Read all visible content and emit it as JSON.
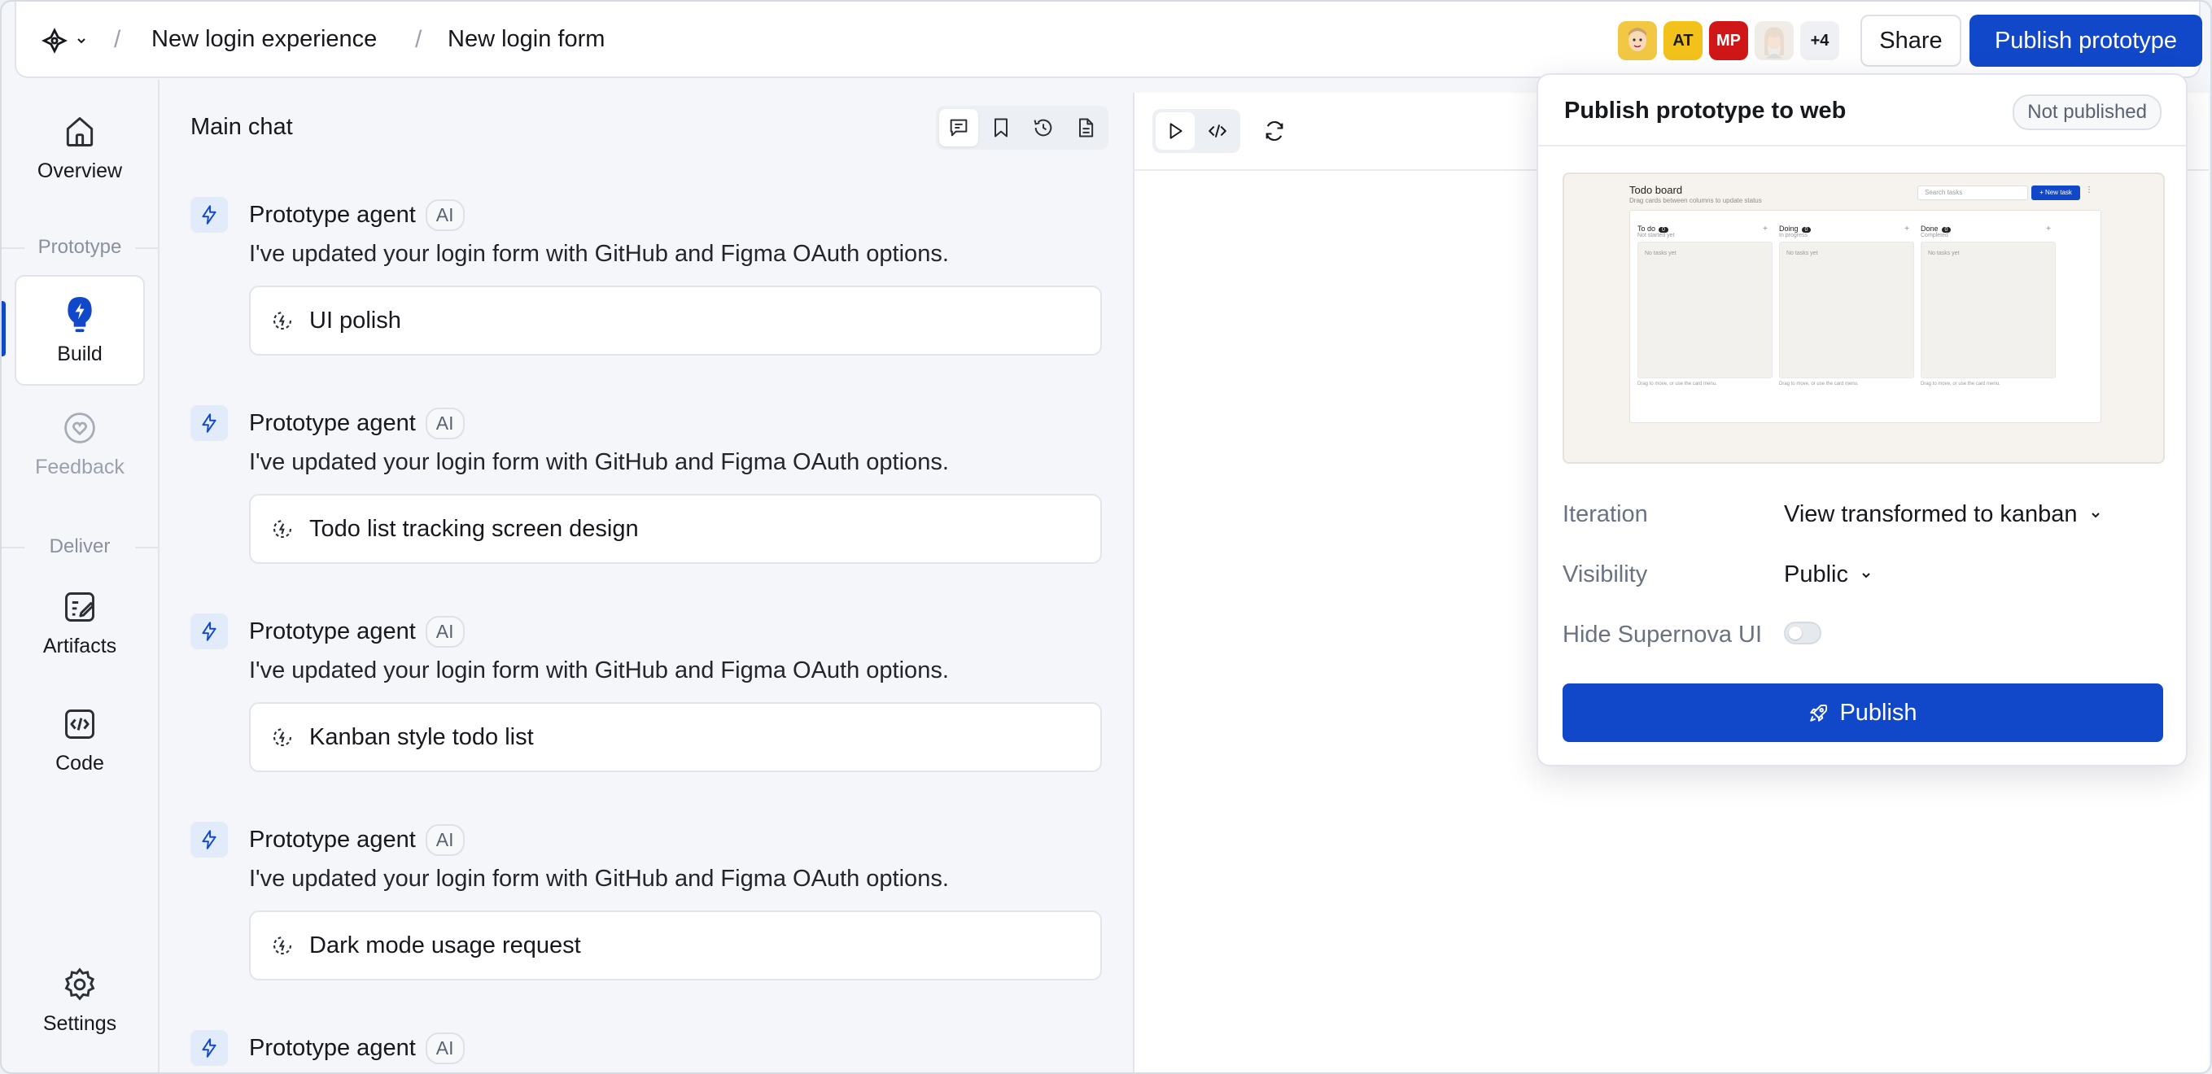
{
  "header": {
    "breadcrumb": [
      "New login experience",
      "New login form"
    ],
    "avatars": [
      {
        "type": "emoji",
        "label": ""
      },
      {
        "type": "initials",
        "label": "AT"
      },
      {
        "type": "initials",
        "label": "MP"
      },
      {
        "type": "photo",
        "label": ""
      }
    ],
    "avatars_more": "+4",
    "share_label": "Share",
    "publish_label": "Publish prototype"
  },
  "sidebar": {
    "overview": "Overview",
    "section_prototype": "Prototype",
    "build": "Build",
    "feedback": "Feedback",
    "section_deliver": "Deliver",
    "artifacts": "Artifacts",
    "code": "Code",
    "settings": "Settings"
  },
  "chat": {
    "title": "Main chat",
    "messages": [
      {
        "agent": "Prototype agent",
        "badge": "AI",
        "text": "I've updated your login form with GitHub and Figma OAuth options.",
        "card": "UI polish"
      },
      {
        "agent": "Prototype agent",
        "badge": "AI",
        "text": "I've updated your login form with GitHub and Figma OAuth options.",
        "card": "Todo list tracking screen design"
      },
      {
        "agent": "Prototype agent",
        "badge": "AI",
        "text": "I've updated your login form with GitHub and Figma OAuth options.",
        "card": "Kanban style todo list"
      },
      {
        "agent": "Prototype agent",
        "badge": "AI",
        "text": "I've updated your login form with GitHub and Figma OAuth options.",
        "card": "Dark mode usage request"
      },
      {
        "agent": "Prototype agent",
        "badge": "AI"
      }
    ]
  },
  "publish_panel": {
    "title": "Publish prototype to web",
    "status": "Not published",
    "iteration_label": "Iteration",
    "iteration_value": "View transformed to kanban",
    "visibility_label": "Visibility",
    "visibility_value": "Public",
    "hide_ui_label": "Hide Supernova UI",
    "hide_ui_enabled": false,
    "publish_button": "Publish",
    "thumbnail": {
      "title": "Todo board",
      "subtitle": "Drag cards between columns to update status",
      "search_placeholder": "Search tasks",
      "new_task": "+ New task",
      "columns": [
        {
          "name": "To do",
          "sub": "Not started yet",
          "empty": "No tasks yet"
        },
        {
          "name": "Doing",
          "sub": "In progress",
          "empty": "No tasks yet"
        },
        {
          "name": "Done",
          "sub": "Completed",
          "empty": "No tasks yet"
        }
      ],
      "hint": "Drag to move, or use the card menu."
    }
  },
  "colors": {
    "accent": "#1148c9",
    "background": "#f4f6f9",
    "avatar_at": "#f2c21b",
    "avatar_mp": "#d01717"
  }
}
